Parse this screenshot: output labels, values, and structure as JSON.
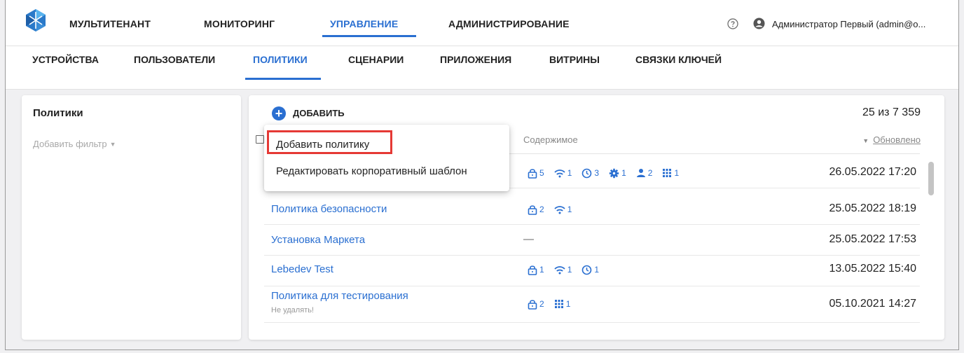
{
  "colors": {
    "accent": "#2a6fd1",
    "highlight": "#e53935"
  },
  "top_nav": {
    "items": [
      {
        "label": "МУЛЬТИТЕНАНТ",
        "active": false
      },
      {
        "label": "МОНИТОРИНГ",
        "active": false
      },
      {
        "label": "УПРАВЛЕНИЕ",
        "active": true
      },
      {
        "label": "АДМИНИСТРИРОВАНИЕ",
        "active": false
      }
    ],
    "help_icon": "help-circle-icon",
    "user_icon": "account-circle-icon",
    "user_name": "Администратор Первый (admin@o..."
  },
  "sub_nav": {
    "items": [
      {
        "label": "УСТРОЙСТВА",
        "active": false
      },
      {
        "label": "ПОЛЬЗОВАТЕЛИ",
        "active": false
      },
      {
        "label": "ПОЛИТИКИ",
        "active": true
      },
      {
        "label": "СЦЕНАРИИ",
        "active": false
      },
      {
        "label": "ПРИЛОЖЕНИЯ",
        "active": false
      },
      {
        "label": "ВИТРИНЫ",
        "active": false
      },
      {
        "label": "СВЯЗКИ КЛЮЧЕЙ",
        "active": false
      }
    ]
  },
  "left_panel": {
    "title": "Политики",
    "filter_label": "Добавить фильтр"
  },
  "main": {
    "add_label": "ДОБАВИТЬ",
    "count": "25 из 7 359",
    "columns": {
      "content": "Содержимое",
      "updated": "Обновлено"
    },
    "rows": [
      {
        "name": "",
        "sub": "",
        "badges": [
          [
            "lock-icon",
            "5"
          ],
          [
            "wifi-icon",
            "1"
          ],
          [
            "clock-icon",
            "3"
          ],
          [
            "gear-icon",
            "1"
          ],
          [
            "person-icon",
            "2"
          ],
          [
            "apps-grid-icon",
            "1"
          ]
        ],
        "date": "26.05.2022 17:20"
      },
      {
        "name": "Политика безопасности",
        "sub": "",
        "badges": [
          [
            "lock-icon",
            "2"
          ],
          [
            "wifi-icon",
            "1"
          ]
        ],
        "date": "25.05.2022 18:19"
      },
      {
        "name": "Установка Маркета",
        "sub": "",
        "badges": [],
        "dash": "—",
        "date": "25.05.2022 17:53"
      },
      {
        "name": "Lebedev Test",
        "sub": "",
        "badges": [
          [
            "lock-icon",
            "1"
          ],
          [
            "wifi-icon",
            "1"
          ],
          [
            "clock-icon",
            "1"
          ]
        ],
        "date": "13.05.2022 15:40"
      },
      {
        "name": "Политика для тестирования",
        "sub": "Не удалять!",
        "badges": [
          [
            "lock-icon",
            "2"
          ],
          [
            "apps-grid-icon",
            "1"
          ]
        ],
        "date": "05.10.2021 14:27"
      }
    ]
  },
  "dropdown": {
    "items": [
      "Добавить политику",
      "Редактировать корпоративный шаблон"
    ],
    "highlighted_index": 0
  }
}
